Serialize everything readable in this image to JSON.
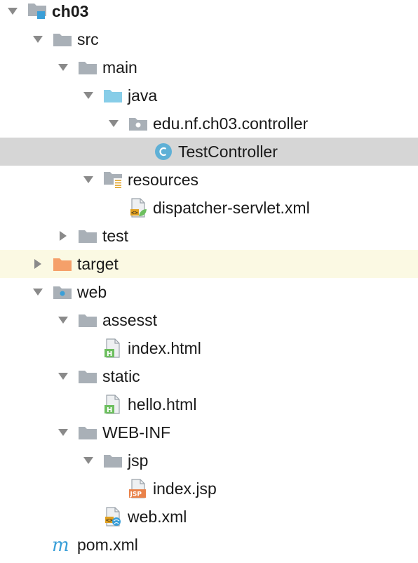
{
  "colors": {
    "folder": "#a9b0b7",
    "source_folder": "#87cde8",
    "excluded_folder": "#f5a06a",
    "selected_row": "#d6d6d6",
    "highlight_row": "#fbf9e3",
    "class_icon": "#5fb0d6",
    "html_badge": "#6dbf5f",
    "jsp_badge": "#e9824a"
  },
  "tree": [
    {
      "label": "ch03",
      "depth": 0,
      "expanded": true,
      "icon": "module-icon",
      "bold": true
    },
    {
      "label": "src",
      "depth": 1,
      "expanded": true,
      "icon": "folder-icon"
    },
    {
      "label": "main",
      "depth": 2,
      "expanded": true,
      "icon": "folder-icon"
    },
    {
      "label": "java",
      "depth": 3,
      "expanded": true,
      "icon": "source-folder-icon"
    },
    {
      "label": "edu.nf.ch03.controller",
      "depth": 4,
      "expanded": true,
      "icon": "package-icon"
    },
    {
      "label": "TestController",
      "depth": 5,
      "icon": "class-icon",
      "selected": true
    },
    {
      "label": "resources",
      "depth": 3,
      "expanded": true,
      "icon": "resources-folder-icon"
    },
    {
      "label": "dispatcher-servlet.xml",
      "depth": 4,
      "icon": "spring-xml-icon"
    },
    {
      "label": "test",
      "depth": 2,
      "expanded": false,
      "icon": "folder-icon"
    },
    {
      "label": "target",
      "depth": 1,
      "expanded": false,
      "icon": "excluded-folder-icon",
      "highlight": true
    },
    {
      "label": "web",
      "depth": 1,
      "expanded": true,
      "icon": "web-folder-icon"
    },
    {
      "label": "assesst",
      "depth": 2,
      "expanded": true,
      "icon": "folder-icon"
    },
    {
      "label": "index.html",
      "depth": 3,
      "icon": "html-file-icon"
    },
    {
      "label": "static",
      "depth": 2,
      "expanded": true,
      "icon": "folder-icon"
    },
    {
      "label": "hello.html",
      "depth": 3,
      "icon": "html-file-icon"
    },
    {
      "label": "WEB-INF",
      "depth": 2,
      "expanded": true,
      "icon": "folder-icon"
    },
    {
      "label": "jsp",
      "depth": 3,
      "expanded": true,
      "icon": "folder-icon"
    },
    {
      "label": "index.jsp",
      "depth": 4,
      "icon": "jsp-file-icon"
    },
    {
      "label": "web.xml",
      "depth": 3,
      "icon": "web-xml-icon"
    },
    {
      "label": "pom.xml",
      "depth": 1,
      "icon": "maven-icon"
    }
  ]
}
